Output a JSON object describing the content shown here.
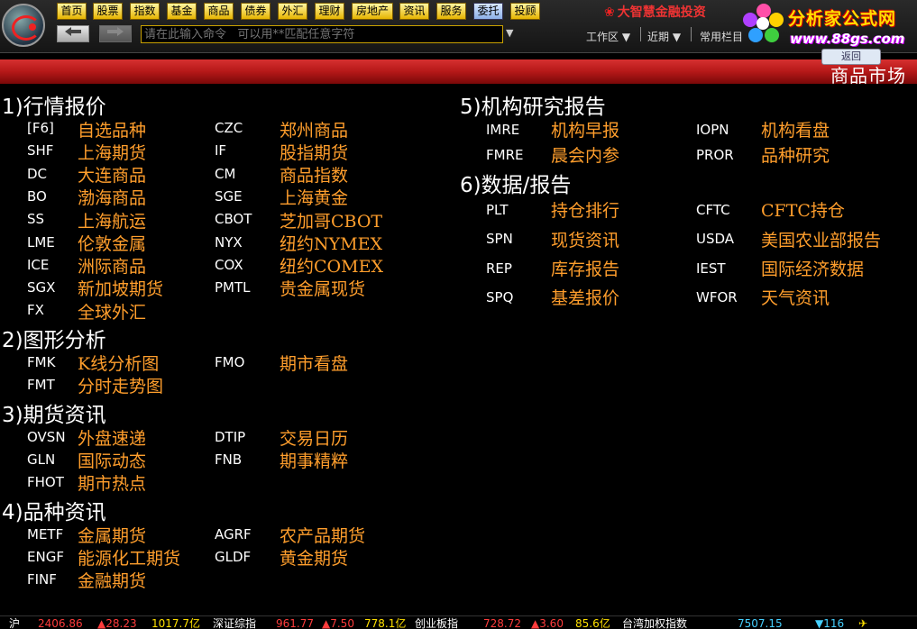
{
  "nav": [
    "首页",
    "股票",
    "指数",
    "基金",
    "商品",
    "债券",
    "外汇",
    "理财",
    "房地产",
    "资讯",
    "服务",
    "委托",
    "投顾"
  ],
  "command": {
    "placeholder": "请在此输入命令   可以用**匹配任意字符"
  },
  "brand": "大智慧金融投资",
  "menus": [
    "工作区",
    "近期",
    "常用栏目"
  ],
  "watermark": {
    "title": "分析家公式网",
    "url": "www.88gs.com"
  },
  "tab_label": "返回",
  "market_title": "商品市场",
  "sections": [
    {
      "title": "1)行情报价",
      "items": [
        {
          "code": "[F6]",
          "name": "自选品种"
        },
        {
          "code": "CZC",
          "name": "郑州商品"
        },
        {
          "code": "SHF",
          "name": "上海期货"
        },
        {
          "code": "IF",
          "name": "股指期货"
        },
        {
          "code": "DC",
          "name": "大连商品"
        },
        {
          "code": "CM",
          "name": "商品指数"
        },
        {
          "code": "BO",
          "name": "渤海商品"
        },
        {
          "code": "SGE",
          "name": "上海黄金"
        },
        {
          "code": "SS",
          "name": "上海航运"
        },
        {
          "code": "CBOT",
          "name": "芝加哥CBOT"
        },
        {
          "code": "LME",
          "name": "伦敦金属"
        },
        {
          "code": "NYX",
          "name": "纽约NYMEX"
        },
        {
          "code": "ICE",
          "name": "洲际商品"
        },
        {
          "code": "COX",
          "name": "纽约COMEX"
        },
        {
          "code": "SGX",
          "name": "新加坡期货"
        },
        {
          "code": "PMTL",
          "name": "贵金属现货"
        },
        {
          "code": "FX",
          "name": "全球外汇"
        }
      ]
    },
    {
      "title": "2)图形分析",
      "items": [
        {
          "code": "FMK",
          "name": "K线分析图"
        },
        {
          "code": "FMO",
          "name": "期市看盘"
        },
        {
          "code": "FMT",
          "name": "分时走势图"
        }
      ]
    },
    {
      "title": "3)期货资讯",
      "items": [
        {
          "code": "OVSN",
          "name": "外盘速递"
        },
        {
          "code": "DTIP",
          "name": "交易日历"
        },
        {
          "code": "GLN",
          "name": "国际动态"
        },
        {
          "code": "FNB",
          "name": "期事精粹"
        },
        {
          "code": "FHOT",
          "name": "期市热点"
        }
      ]
    },
    {
      "title": "4)品种资讯",
      "items": [
        {
          "code": "METF",
          "name": "金属期货"
        },
        {
          "code": "AGRF",
          "name": "农产品期货"
        },
        {
          "code": "ENGF",
          "name": "能源化工期货"
        },
        {
          "code": "GLDF",
          "name": "黄金期货"
        },
        {
          "code": "FINF",
          "name": "金融期货"
        }
      ]
    },
    {
      "title": "5)机构研究报告",
      "items": [
        {
          "code": "IMRE",
          "name": "机构早报"
        },
        {
          "code": "IOPN",
          "name": "机构看盘"
        },
        {
          "code": "FMRE",
          "name": "晨会内参"
        },
        {
          "code": "PROR",
          "name": "品种研究"
        }
      ]
    },
    {
      "title": "6)数据/报告",
      "items": [
        {
          "code": "PLT",
          "name": "持仓排行"
        },
        {
          "code": "CFTC",
          "name": "CFTC持仓"
        },
        {
          "code": "SPN",
          "name": "现货资讯"
        },
        {
          "code": "USDA",
          "name": "美国农业部报告"
        },
        {
          "code": "REP",
          "name": "库存报告"
        },
        {
          "code": "IEST",
          "name": "国际经济数据"
        },
        {
          "code": "SPQ",
          "name": "基差报价"
        },
        {
          "code": "WFOR",
          "name": "天气资讯"
        }
      ]
    }
  ],
  "status": {
    "sh_label": "沪",
    "sh_value": "2406.86",
    "sh_change": "▲28.23",
    "sh_amount": "1017.7亿",
    "sz_label": "深证综指",
    "sz_value": "961.77",
    "sz_change": "▲7.50",
    "sz_amount": "778.1亿",
    "cy_label": "创业板指",
    "cy_value": "728.72",
    "cy_change": "▲3.60",
    "cy_amount": "85.6亿",
    "tw_label": "台湾加权指数",
    "tw_value": "7507.15",
    "tw_change": "▼116"
  }
}
